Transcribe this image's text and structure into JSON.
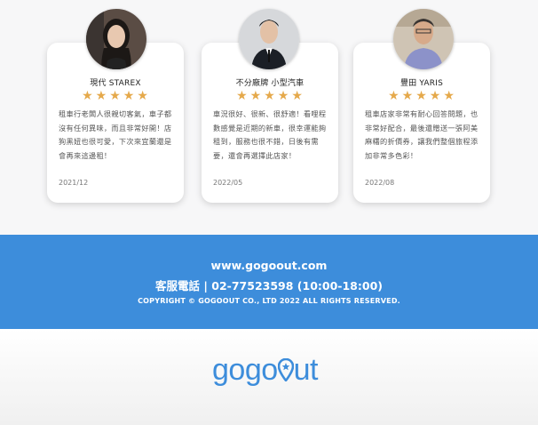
{
  "reviews": [
    {
      "car": "現代 STAREX",
      "rating": 5,
      "comment": "租車行老闆人很親切客氣，車子都沒有任何異味，而且非常好開！店狗黑妞也很可愛，下次來宜蘭還是會再來這邊租！",
      "date": "2021/12"
    },
    {
      "car": "不分廠牌 小型汽車",
      "rating": 5,
      "comment": "車況很好、很新、很舒適！看哩程數感覺是近期的新車，很幸運能夠租到，服務也很不錯，日後有需要，還會再選擇此店家！",
      "date": "2022/05"
    },
    {
      "car": "豐田 YARIS",
      "rating": 5,
      "comment": "租車店家非常有耐心回答問題，也非常好配合，最後還贈送一張阿美麻糬的折價券，讓我們整個旅程添加非常多色彩！",
      "date": "2022/08"
    }
  ],
  "footer": {
    "url": "www.gogoout.com",
    "phone": "客服電話 | 02-77523598 (10:00-18:00)",
    "copyright": "COPYRIGHT © GOGOOUT CO., LTD 2022 ALL RIGHTS RESERVED."
  },
  "logo": {
    "text_left": "gogo",
    "text_right": "ut",
    "color": "#3d8ddb"
  },
  "colors": {
    "star": "#e5a94b",
    "footer_bg": "#3d8ddb"
  }
}
